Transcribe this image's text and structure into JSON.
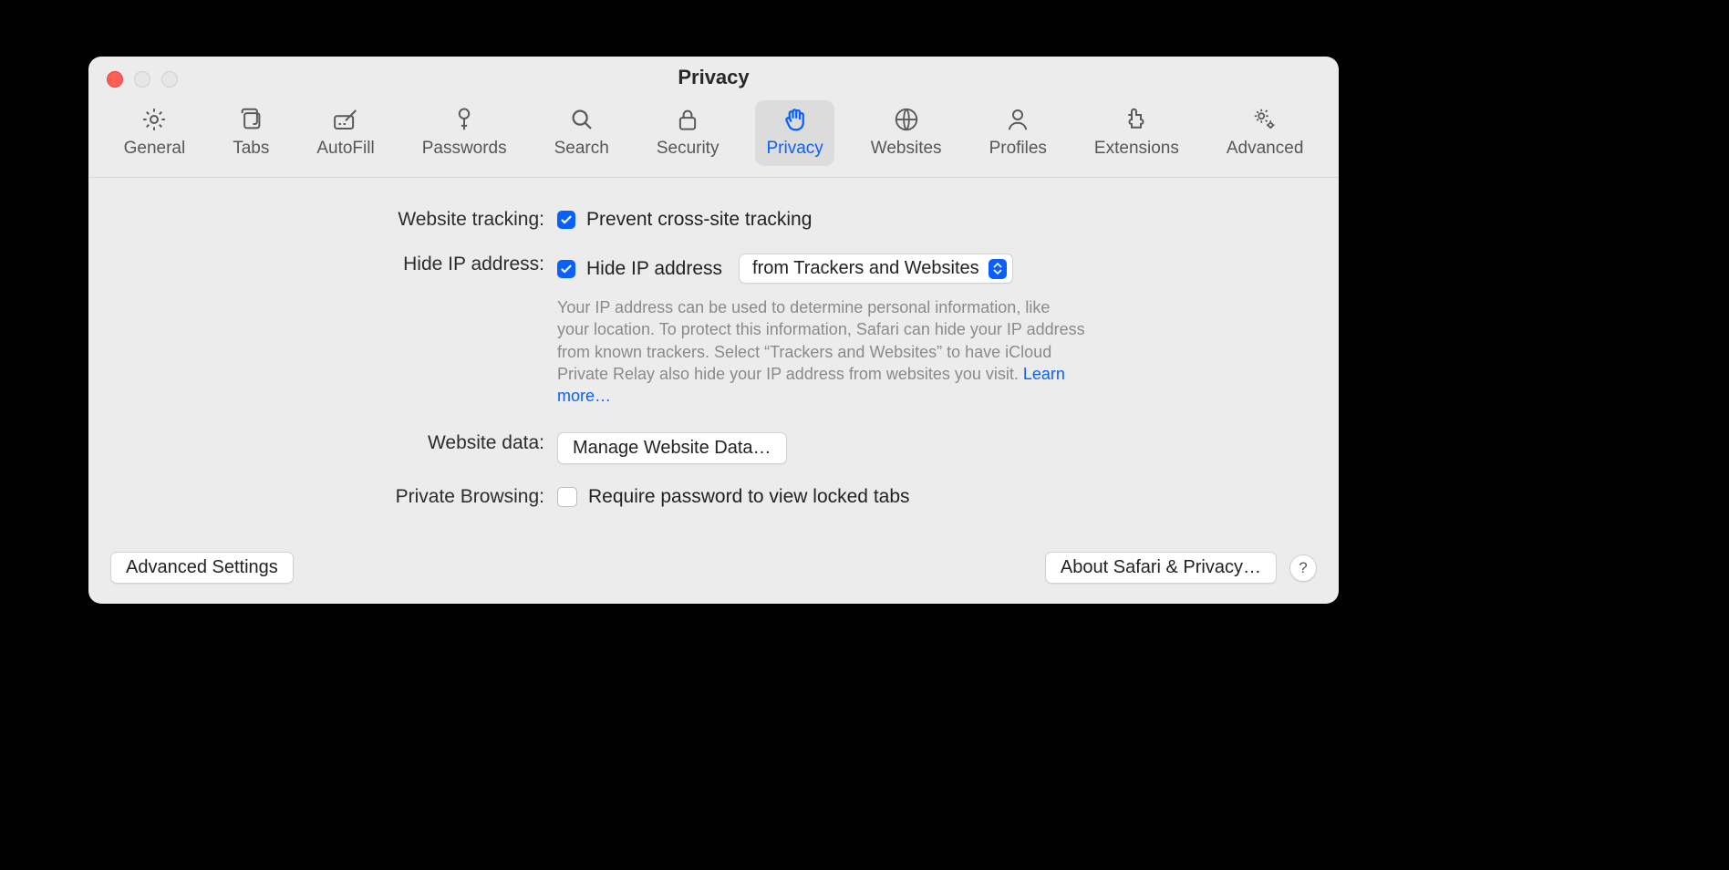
{
  "window": {
    "title": "Privacy"
  },
  "tabs": [
    {
      "id": "general",
      "label": "General"
    },
    {
      "id": "tabs",
      "label": "Tabs"
    },
    {
      "id": "autofill",
      "label": "AutoFill"
    },
    {
      "id": "passwords",
      "label": "Passwords"
    },
    {
      "id": "search",
      "label": "Search"
    },
    {
      "id": "security",
      "label": "Security"
    },
    {
      "id": "privacy",
      "label": "Privacy",
      "selected": true
    },
    {
      "id": "websites",
      "label": "Websites"
    },
    {
      "id": "profiles",
      "label": "Profiles"
    },
    {
      "id": "extensions",
      "label": "Extensions"
    },
    {
      "id": "advanced",
      "label": "Advanced"
    }
  ],
  "sections": {
    "website_tracking": {
      "label": "Website tracking:",
      "checkbox_label": "Prevent cross-site tracking",
      "checked": true
    },
    "hide_ip": {
      "label": "Hide IP address:",
      "checkbox_label": "Hide IP address",
      "checked": true,
      "dropdown_value": "from Trackers and Websites",
      "description": "Your IP address can be used to determine personal information, like your location. To protect this information, Safari can hide your IP address from known trackers. Select “Trackers and Websites” to have iCloud Private Relay also hide your IP address from websites you visit. ",
      "learn_more": "Learn more…"
    },
    "website_data": {
      "label": "Website data:",
      "button_label": "Manage Website Data…"
    },
    "private_browsing": {
      "label": "Private Browsing:",
      "checkbox_label": "Require password to view locked tabs",
      "checked": false
    }
  },
  "buttons": {
    "advanced_settings": "Advanced Settings",
    "about": "About Safari & Privacy…",
    "help": "?"
  }
}
